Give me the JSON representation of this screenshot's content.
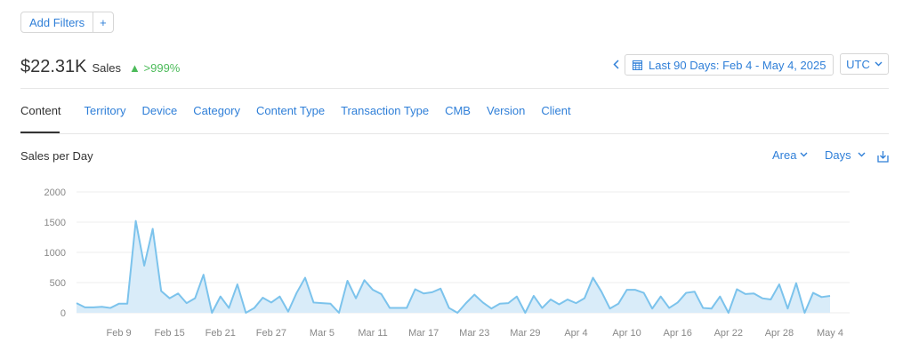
{
  "filters": {
    "add_label": "Add Filters",
    "plus_label": "+"
  },
  "summary": {
    "amount": "$22.31K",
    "label": "Sales",
    "change": "▲ >999%"
  },
  "date_range": {
    "prev_icon": "chevron-left-icon",
    "calendar_icon": "calendar-icon",
    "label": "Last 90 Days: Feb 4 - May 4, 2025"
  },
  "timezone": {
    "label": "UTC",
    "arrow": "⌄"
  },
  "tabs": [
    {
      "label": "Content",
      "active": true
    },
    {
      "label": "Territory"
    },
    {
      "label": "Device"
    },
    {
      "label": "Category"
    },
    {
      "label": "Content Type"
    },
    {
      "label": "Transaction Type"
    },
    {
      "label": "CMB"
    },
    {
      "label": "Version"
    },
    {
      "label": "Client"
    }
  ],
  "chart_controls": {
    "title": "Sales per Day",
    "type_label": "Area",
    "interval_label": "Days",
    "download_icon": "download-icon"
  },
  "colors": {
    "accent": "#2f7fd8",
    "positive": "#4cbb5a",
    "series_line": "#7cc3ec",
    "series_fill": "#d9ecf9"
  },
  "chart_data": {
    "type": "area",
    "ylabel": "",
    "xlabel": "",
    "ylim": [
      0,
      2000
    ],
    "yticks": [
      0,
      500,
      1000,
      1500,
      2000
    ],
    "xtick_labels": [
      "Feb 9",
      "Feb 15",
      "Feb 21",
      "Feb 27",
      "Mar 5",
      "Mar 11",
      "Mar 17",
      "Mar 23",
      "Mar 29",
      "Apr 4",
      "Apr 10",
      "Apr 16",
      "Apr 22",
      "Apr 28",
      "May 4"
    ],
    "xtick_day_index": [
      5,
      11,
      17,
      23,
      29,
      35,
      41,
      47,
      53,
      59,
      65,
      71,
      77,
      83,
      89
    ],
    "grid": true,
    "series": [
      {
        "values": [
          160,
          90,
          90,
          100,
          80,
          150,
          150,
          1520,
          780,
          1390,
          360,
          240,
          320,
          160,
          240,
          630,
          0,
          270,
          80,
          470,
          0,
          80,
          250,
          170,
          270,
          20,
          330,
          580,
          170,
          160,
          150,
          0,
          530,
          240,
          540,
          380,
          310,
          80,
          80,
          80,
          390,
          320,
          340,
          400,
          80,
          0,
          160,
          300,
          170,
          70,
          150,
          160,
          270,
          0,
          280,
          80,
          220,
          140,
          220,
          160,
          240,
          580,
          350,
          70,
          150,
          380,
          380,
          330,
          70,
          270,
          80,
          170,
          330,
          350,
          80,
          70,
          270,
          0,
          390,
          310,
          320,
          240,
          220,
          470,
          70,
          490,
          0,
          330,
          260,
          280
        ]
      }
    ]
  }
}
